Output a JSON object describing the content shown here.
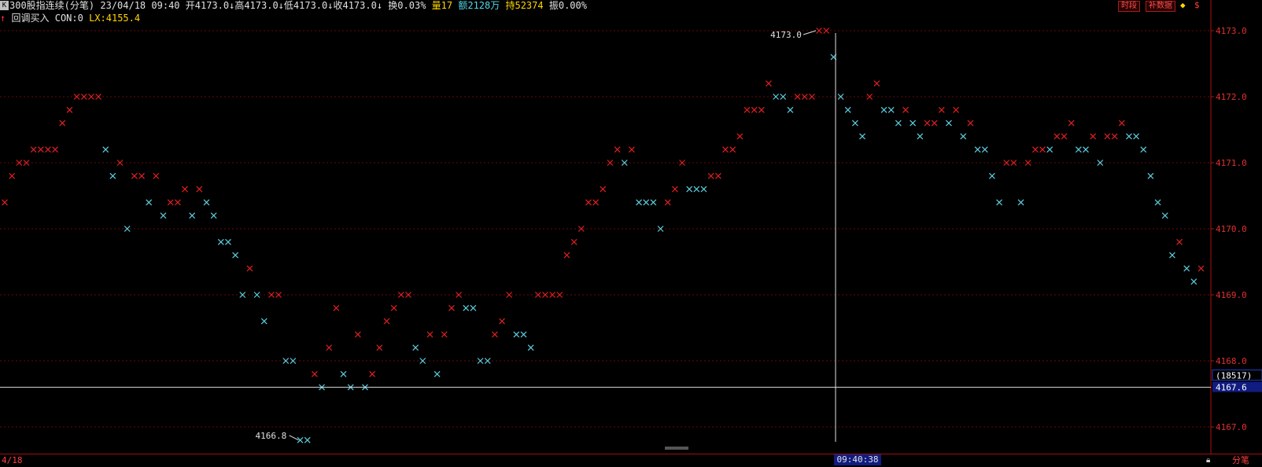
{
  "header": {
    "k_icon": "K",
    "name": "300股指连续(分笔)",
    "date": "23/04/18",
    "time": "09:40",
    "open": "开4173.0↓",
    "high": "高4173.0↓",
    "low": "低4173.0↓",
    "close": "收4173.0↓",
    "turnover": "换0.03%",
    "volume": "量17",
    "amount": "额2128万",
    "hold": "持52374",
    "amplitude": "振0.00%",
    "btn_period": "时段",
    "btn_fill": "补数据",
    "colors": {
      "red": "#ff3030",
      "cyan": "#54d8e8",
      "yellow": "#ffd700"
    }
  },
  "indicator": {
    "arrow": "↑",
    "name": "回调买入",
    "con": "CON:0",
    "lx": "LX:4155.4"
  },
  "footer": {
    "date": "4/18",
    "crosshair_time": "09:40:38",
    "mode": "分笔",
    "lock_icon": "lock-icon"
  },
  "chart_data": {
    "type": "scatter",
    "marker": "x",
    "ylim": [
      4166.7,
      4173.1
    ],
    "y_ticks": [
      "4173.0",
      "4172.0",
      "4171.0",
      "4170.0",
      "4169.0",
      "4168.0",
      "4167.0"
    ],
    "crosshair_price": "4167.6",
    "crosshair_count": "(18517)",
    "high_label": "4173.0",
    "low_label": "4166.8",
    "series": [
      {
        "color": "red",
        "points": [
          [
            0,
            4170.4
          ],
          [
            1,
            4170.8
          ],
          [
            2,
            4171.0
          ],
          [
            3,
            4171.0
          ],
          [
            4,
            4171.2
          ],
          [
            5,
            4171.2
          ],
          [
            6,
            4171.2
          ],
          [
            7,
            4171.2
          ],
          [
            8,
            4171.6
          ],
          [
            9,
            4171.8
          ],
          [
            10,
            4172.0
          ],
          [
            11,
            4172.0
          ],
          [
            12,
            4172.0
          ],
          [
            13,
            4172.0
          ],
          [
            16,
            4171.0
          ],
          [
            18,
            4170.8
          ],
          [
            19,
            4170.8
          ],
          [
            21,
            4170.8
          ],
          [
            23,
            4170.4
          ],
          [
            24,
            4170.4
          ],
          [
            25,
            4170.6
          ],
          [
            27,
            4170.6
          ],
          [
            34,
            4169.4
          ],
          [
            37,
            4169.0
          ],
          [
            38,
            4169.0
          ],
          [
            43,
            4167.8
          ],
          [
            45,
            4168.2
          ],
          [
            46,
            4168.8
          ],
          [
            49,
            4168.4
          ],
          [
            51,
            4167.8
          ],
          [
            52,
            4168.2
          ],
          [
            53,
            4168.6
          ],
          [
            54,
            4168.8
          ],
          [
            55,
            4169.0
          ],
          [
            56,
            4169.0
          ],
          [
            59,
            4168.4
          ],
          [
            61,
            4168.4
          ],
          [
            62,
            4168.8
          ],
          [
            63,
            4169.0
          ],
          [
            68,
            4168.4
          ],
          [
            69,
            4168.6
          ],
          [
            70,
            4169.0
          ],
          [
            74,
            4169.0
          ],
          [
            75,
            4169.0
          ],
          [
            76,
            4169.0
          ],
          [
            77,
            4169.0
          ],
          [
            78,
            4169.6
          ],
          [
            79,
            4169.8
          ],
          [
            80,
            4170.0
          ],
          [
            81,
            4170.4
          ],
          [
            82,
            4170.4
          ],
          [
            83,
            4170.6
          ],
          [
            84,
            4171.0
          ],
          [
            85,
            4171.2
          ],
          [
            87,
            4171.2
          ],
          [
            92,
            4170.4
          ],
          [
            93,
            4170.6
          ],
          [
            94,
            4171.0
          ],
          [
            98,
            4170.8
          ],
          [
            99,
            4170.8
          ],
          [
            100,
            4171.2
          ],
          [
            101,
            4171.2
          ],
          [
            102,
            4171.4
          ],
          [
            103,
            4171.8
          ],
          [
            104,
            4171.8
          ],
          [
            105,
            4171.8
          ],
          [
            106,
            4172.2
          ],
          [
            110,
            4172.0
          ],
          [
            111,
            4172.0
          ],
          [
            112,
            4172.0
          ],
          [
            113,
            4173.0
          ],
          [
            114,
            4173.0
          ],
          [
            120,
            4172.0
          ],
          [
            121,
            4172.2
          ],
          [
            125,
            4171.8
          ],
          [
            128,
            4171.6
          ],
          [
            129,
            4171.6
          ],
          [
            130,
            4171.8
          ],
          [
            132,
            4171.8
          ],
          [
            134,
            4171.6
          ],
          [
            139,
            4171.0
          ],
          [
            140,
            4171.0
          ],
          [
            142,
            4171.0
          ],
          [
            143,
            4171.2
          ],
          [
            144,
            4171.2
          ],
          [
            146,
            4171.4
          ],
          [
            147,
            4171.4
          ],
          [
            148,
            4171.6
          ],
          [
            151,
            4171.4
          ],
          [
            153,
            4171.4
          ],
          [
            154,
            4171.4
          ],
          [
            155,
            4171.6
          ],
          [
            163,
            4169.8
          ],
          [
            166,
            4169.4
          ]
        ]
      },
      {
        "color": "cyan",
        "points": [
          [
            14,
            4171.2
          ],
          [
            15,
            4170.8
          ],
          [
            17,
            4170.0
          ],
          [
            20,
            4170.4
          ],
          [
            22,
            4170.2
          ],
          [
            26,
            4170.2
          ],
          [
            28,
            4170.4
          ],
          [
            29,
            4170.2
          ],
          [
            30,
            4169.8
          ],
          [
            31,
            4169.8
          ],
          [
            32,
            4169.6
          ],
          [
            33,
            4169.0
          ],
          [
            35,
            4169.0
          ],
          [
            36,
            4168.6
          ],
          [
            39,
            4168.0
          ],
          [
            40,
            4168.0
          ],
          [
            41,
            4166.8
          ],
          [
            42,
            4166.8
          ],
          [
            44,
            4167.6
          ],
          [
            47,
            4167.8
          ],
          [
            48,
            4167.6
          ],
          [
            50,
            4167.6
          ],
          [
            57,
            4168.2
          ],
          [
            58,
            4168.0
          ],
          [
            60,
            4167.8
          ],
          [
            64,
            4168.8
          ],
          [
            65,
            4168.8
          ],
          [
            66,
            4168.0
          ],
          [
            67,
            4168.0
          ],
          [
            71,
            4168.4
          ],
          [
            72,
            4168.4
          ],
          [
            73,
            4168.2
          ],
          [
            86,
            4171.0
          ],
          [
            88,
            4170.4
          ],
          [
            89,
            4170.4
          ],
          [
            90,
            4170.4
          ],
          [
            91,
            4170.0
          ],
          [
            95,
            4170.6
          ],
          [
            96,
            4170.6
          ],
          [
            97,
            4170.6
          ],
          [
            107,
            4172.0
          ],
          [
            108,
            4172.0
          ],
          [
            109,
            4171.8
          ],
          [
            115,
            4172.6
          ],
          [
            116,
            4172.0
          ],
          [
            117,
            4171.8
          ],
          [
            118,
            4171.6
          ],
          [
            119,
            4171.4
          ],
          [
            122,
            4171.8
          ],
          [
            123,
            4171.8
          ],
          [
            124,
            4171.6
          ],
          [
            126,
            4171.6
          ],
          [
            127,
            4171.4
          ],
          [
            131,
            4171.6
          ],
          [
            133,
            4171.4
          ],
          [
            135,
            4171.2
          ],
          [
            136,
            4171.2
          ],
          [
            137,
            4170.8
          ],
          [
            138,
            4170.4
          ],
          [
            141,
            4170.4
          ],
          [
            145,
            4171.2
          ],
          [
            149,
            4171.2
          ],
          [
            150,
            4171.2
          ],
          [
            152,
            4171.0
          ],
          [
            156,
            4171.4
          ],
          [
            157,
            4171.4
          ],
          [
            158,
            4171.2
          ],
          [
            159,
            4170.8
          ],
          [
            160,
            4170.4
          ],
          [
            161,
            4170.2
          ],
          [
            162,
            4169.6
          ],
          [
            164,
            4169.4
          ],
          [
            165,
            4169.2
          ]
        ]
      }
    ]
  }
}
